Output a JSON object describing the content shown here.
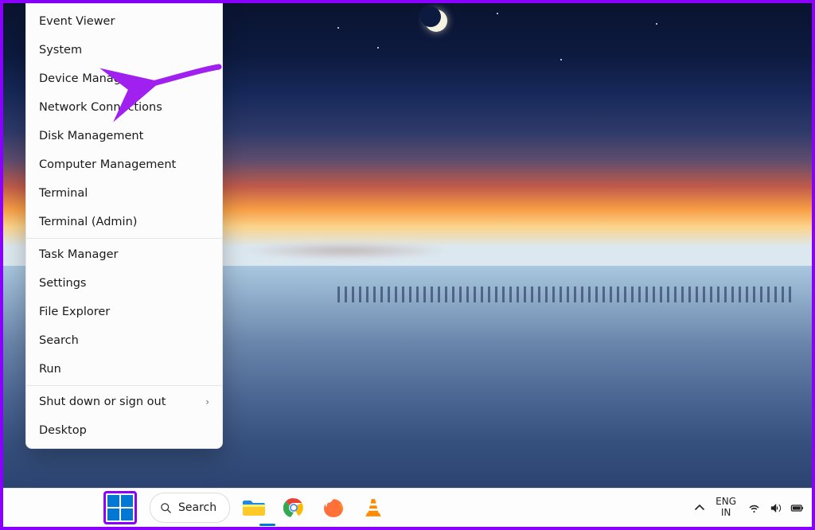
{
  "menu": {
    "groups": [
      [
        "Event Viewer",
        "System",
        "Device Manager",
        "Network Connections",
        "Disk Management",
        "Computer Management",
        "Terminal",
        "Terminal (Admin)"
      ],
      [
        "Task Manager",
        "Settings",
        "File Explorer",
        "Search",
        "Run"
      ],
      [
        "Shut down or sign out",
        "Desktop"
      ]
    ],
    "has_submenu_label": "Shut down or sign out"
  },
  "taskbar": {
    "search_label": "Search",
    "lang_top": "ENG",
    "lang_bottom": "IN"
  },
  "annotation": {
    "target_label": "Device Manager",
    "color": "#a020f0"
  }
}
